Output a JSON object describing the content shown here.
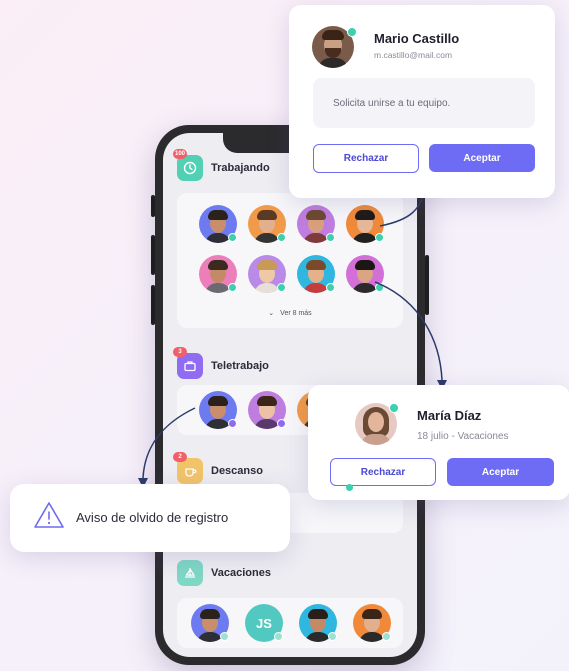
{
  "sections": {
    "working": {
      "title": "Trabajando",
      "badge": "100",
      "see_more": "Ver 8 más"
    },
    "remote": {
      "title": "Teletrabajo",
      "badge": "3"
    },
    "break": {
      "title": "Descanso",
      "badge": "2"
    },
    "vacation": {
      "title": "Vacaciones",
      "badge": ""
    }
  },
  "vacation_initials": "JS",
  "popup_mario": {
    "name": "Mario Castillo",
    "email": "m.castillo@mail.com",
    "message": "Solicita unirse a tu equipo.",
    "reject_label": "Rechazar",
    "accept_label": "Aceptar"
  },
  "popup_maria": {
    "name": "María Díaz",
    "detail": "18 julio - Vacaciones",
    "reject_label": "Rechazar",
    "accept_label": "Aceptar"
  },
  "alert": {
    "text": "Aviso de olvido de registro"
  },
  "colors": {
    "accent": "#6e6cf4",
    "working": "#52d0b4",
    "remote": "#8f6cf2",
    "break": "#f2c46a",
    "vacation": "#7fd7c6",
    "online": "#3ccfb0"
  },
  "icons": {
    "working": "clock-icon",
    "remote": "briefcase-icon",
    "break": "coffee-icon",
    "vacation": "sailboat-icon",
    "alert": "warning-triangle-icon"
  }
}
